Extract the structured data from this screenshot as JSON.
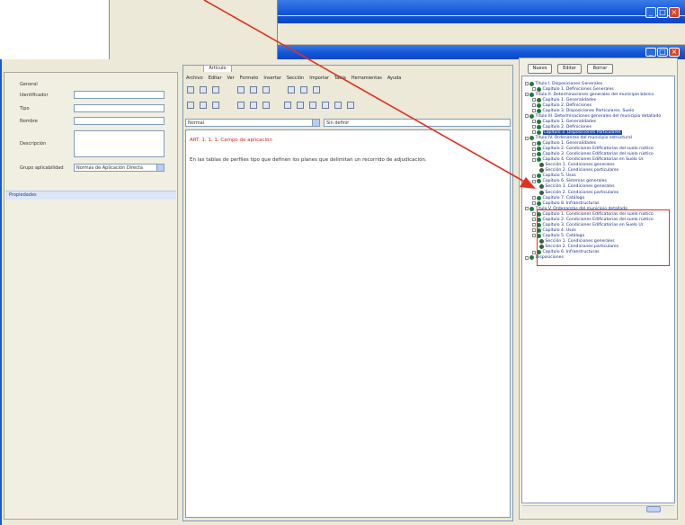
{
  "editor": {
    "tab_label": "Artículo",
    "menu": [
      "Archivo",
      "Editar",
      "Ver",
      "Formato",
      "Insertar",
      "Sección",
      "Importar",
      "Tabla",
      "Herramientas",
      "Ayuda"
    ],
    "style_select": "Normal",
    "font_select": "Sin definir",
    "heading": "ART. 1. 1. 1. Campo de aplicación",
    "body": "En las tablas de perfiles tipo que definen los planes que delimitan un recorrido de adjudicación."
  },
  "form": {
    "section_label": "General",
    "fields": [
      {
        "label": "Identificador",
        "value": ""
      },
      {
        "label": "Tipo",
        "value": ""
      },
      {
        "label": "Nombre",
        "value": ""
      },
      {
        "label": "Descripción",
        "value": ""
      }
    ],
    "select_label": "Grupo aplicabilidad",
    "select_value": "Normas de Aplicación Directa",
    "props_tab": "Propiedades"
  },
  "tree_panel": {
    "buttons": [
      "Nuevo",
      "Editar",
      "Borrar"
    ],
    "nodes": [
      {
        "indent": 0,
        "text": "Título I. Disposiciones Generales"
      },
      {
        "indent": 1,
        "text": "Capítulo 1. Definiciones Generales"
      },
      {
        "indent": 0,
        "text": "Título II. Determinaciones generales del municipio básico"
      },
      {
        "indent": 1,
        "text": "Capítulo 1. Generalidades"
      },
      {
        "indent": 1,
        "text": "Capítulo 2. Definiciones"
      },
      {
        "indent": 1,
        "text": "Capítulo 3. Disposiciones Particulares. Suelo"
      },
      {
        "indent": 0,
        "text": "Título III. Determinaciones generales del municipio detallado"
      },
      {
        "indent": 1,
        "text": "Capítulo 1. Generalidades"
      },
      {
        "indent": 1,
        "text": "Capítulo 2. Definiciones"
      },
      {
        "indent": 1,
        "text": "Capítulo 3. Disposiciones Particulares",
        "selected": true
      },
      {
        "indent": 0,
        "text": "Título IV. Ordenanzas del municipio estructural"
      },
      {
        "indent": 1,
        "text": "Capítulo 1. Generalidades"
      },
      {
        "indent": 1,
        "text": "Capítulo 2. Condiciones Edificatorias del suelo rústico"
      },
      {
        "indent": 1,
        "text": "Capítulo 3. Condiciones Edificatorias del suelo rústico"
      },
      {
        "indent": 1,
        "text": "Capítulo 4. Condiciones Edificatorias en Suelo Ur."
      },
      {
        "indent": 2,
        "text": "Sección 1. Condiciones generales"
      },
      {
        "indent": 2,
        "text": "Sección 2. Condiciones particulares"
      },
      {
        "indent": 1,
        "text": "Capítulo 5. Usos"
      },
      {
        "indent": 1,
        "text": "Capítulo 6. Sistemas generales"
      },
      {
        "indent": 2,
        "text": "Sección 1. Condiciones generales"
      },
      {
        "indent": 2,
        "text": "Sección 2. Condiciones particulares"
      },
      {
        "indent": 1,
        "text": "Capítulo 7. Catálogo"
      },
      {
        "indent": 1,
        "text": "Capítulo 8. Infraestructuras"
      },
      {
        "indent": 0,
        "text": "Título V. Ordenanzas del municipio detallado"
      },
      {
        "indent": 1,
        "text": "Capítulo 1. Condiciones Edificatorias del suelo rústico"
      },
      {
        "indent": 1,
        "text": "Capítulo 2. Condiciones Edificatorias del suelo rústico"
      },
      {
        "indent": 1,
        "text": "Capítulo 3. Condiciones Edificatorias en Suelo Ur."
      },
      {
        "indent": 1,
        "text": "Capítulo 4. Usos"
      },
      {
        "indent": 1,
        "text": "Capítulo 5. Catálogo"
      },
      {
        "indent": 2,
        "text": "Sección 1. Condiciones generales"
      },
      {
        "indent": 2,
        "text": "Sección 2. Condiciones particulares"
      },
      {
        "indent": 1,
        "text": "Capítulo 6. Infraestructuras"
      },
      {
        "indent": 0,
        "text": "Disposiciones"
      }
    ]
  },
  "window_buttons": [
    "_",
    "□",
    "×"
  ],
  "colors": {
    "titlebar": "#1659d8",
    "highlight_box": "#e03020",
    "arrow": "#e03020",
    "selection": "#2048a8",
    "heading_text": "#e02020"
  }
}
